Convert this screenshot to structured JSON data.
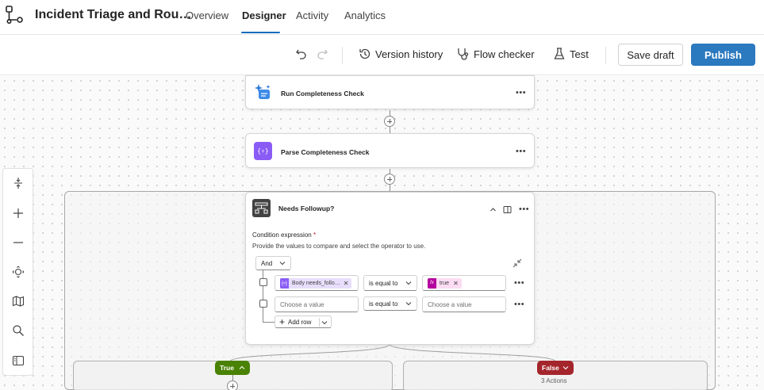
{
  "header": {
    "app_title": "Incident Triage and Rou…",
    "tabs": [
      {
        "label": "Overview",
        "active": false
      },
      {
        "label": "Designer",
        "active": true
      },
      {
        "label": "Activity",
        "active": false
      },
      {
        "label": "Analytics",
        "active": false
      }
    ]
  },
  "toolbar": {
    "version_history": "Version history",
    "flow_checker": "Flow checker",
    "test": "Test",
    "save_draft": "Save draft",
    "publish": "Publish"
  },
  "canvas": {
    "nodes": [
      {
        "title": "Run Completeness Check",
        "icon": "ai-sparkle-icon",
        "icon_color": "#2f7bdc"
      },
      {
        "title": "Parse Completeness Check",
        "icon": "braces-icon",
        "icon_color": "#8a5cf5"
      }
    ],
    "condition": {
      "title": "Needs Followup?",
      "expression_label": "Condition expression",
      "required_marker": "*",
      "help_text": "Provide the values to compare and select the operator to use.",
      "group_operator": "And",
      "rows": [
        {
          "left_token": "Body needs_follo…",
          "operator": "is equal to",
          "right_token": "true"
        },
        {
          "left_placeholder": "Choose a value",
          "operator": "is equal to",
          "right_placeholder": "Choose a value"
        }
      ],
      "add_row": "Add row"
    },
    "branches": {
      "true_label": "True",
      "false_label": "False",
      "false_actions": "3 Actions",
      "true_color": "#498205",
      "false_color": "#a4262c"
    }
  },
  "colors": {
    "accent": "#0f6cbd",
    "publish_bg": "#2b79bf",
    "token_purple": "#8a5cf5",
    "token_magenta": "#b4009e"
  }
}
